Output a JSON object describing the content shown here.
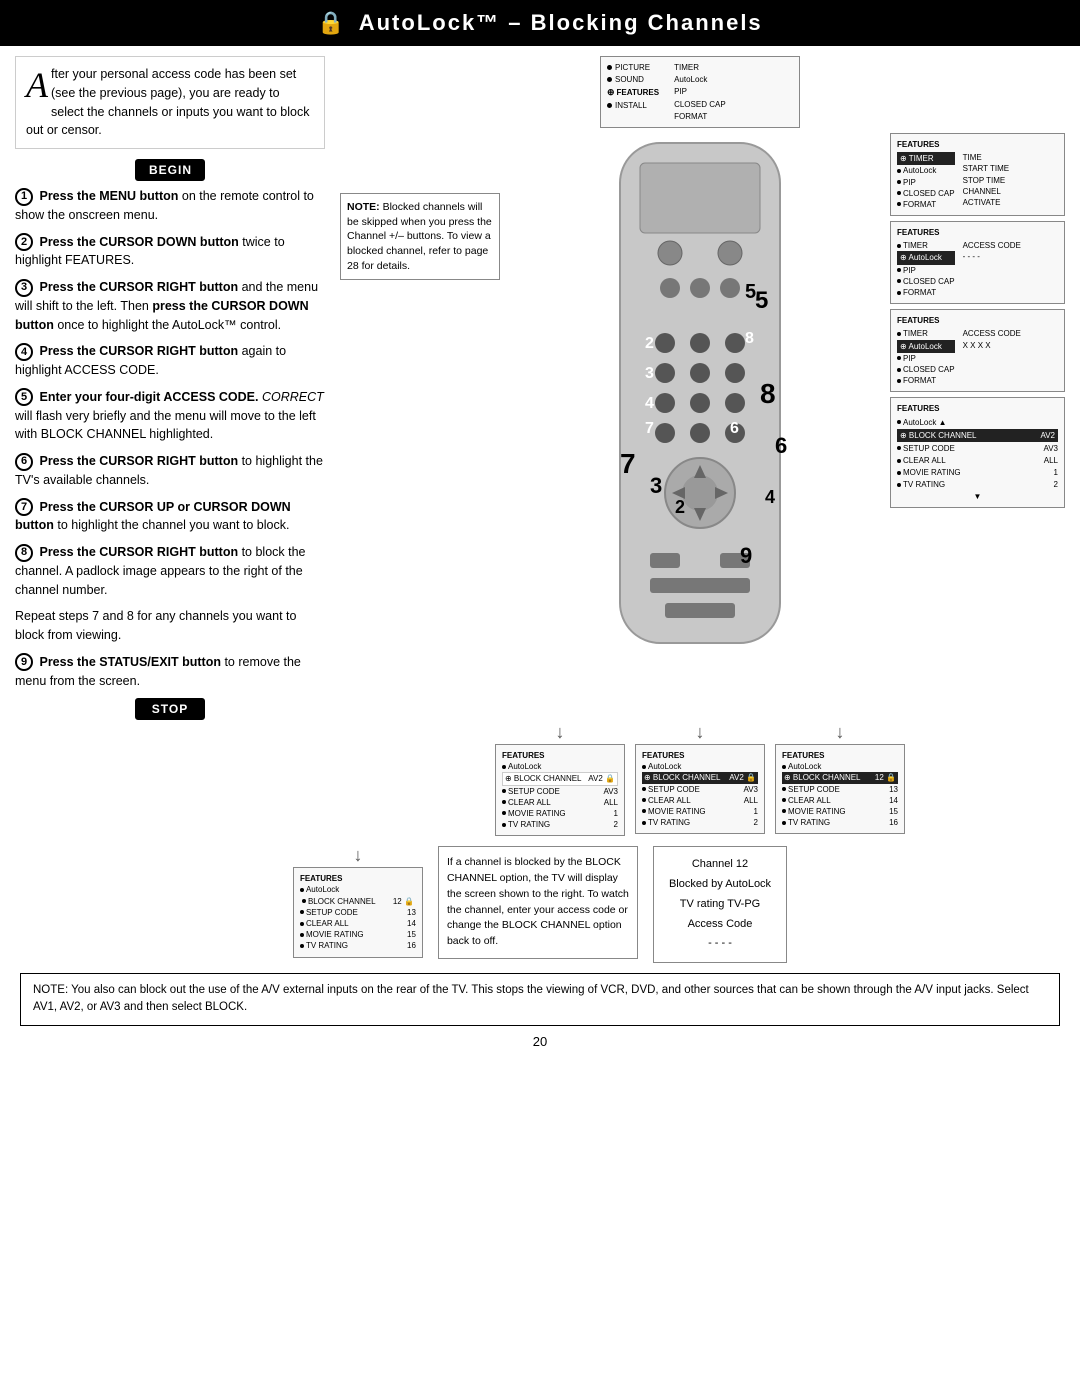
{
  "header": {
    "title": "AutoLock™ – Blocking Channels"
  },
  "intro": {
    "drop_cap": "A",
    "text": "fter your personal access code has been set (see the previous page), you are ready to select the channels or inputs you want to block out or censor."
  },
  "begin_label": "BEGIN",
  "stop_label": "STOP",
  "steps": [
    {
      "num": "1",
      "content": "Press the MENU button on the remote control to show the onscreen menu."
    },
    {
      "num": "2",
      "content": "Press the CURSOR DOWN button twice to highlight FEATURES."
    },
    {
      "num": "3",
      "content": "Press the CURSOR RIGHT button and the menu will shift to the left. Then press the CURSOR DOWN button once to highlight the AutoLock™ control."
    },
    {
      "num": "4",
      "content": "Press the CURSOR RIGHT button again to highlight ACCESS CODE."
    },
    {
      "num": "5",
      "content": "Enter your four-digit ACCESS CODE. CORRECT will flash very briefly and the menu will move to the left with BLOCK CHANNEL highlighted."
    },
    {
      "num": "6",
      "content": "Press the CURSOR RIGHT button to highlight the TV's available channels."
    },
    {
      "num": "7",
      "content": "Press the CURSOR UP or CURSOR DOWN button to highlight the channel you want to block."
    },
    {
      "num": "8",
      "content": "Press the CURSOR RIGHT button to block the channel. A padlock image appears to the right of the channel number."
    },
    {
      "num": "repeat",
      "content": "Repeat steps 7 and 8 for any channels you want to block from viewing."
    },
    {
      "num": "9",
      "content": "Press the STATUS/EXIT button to remove the menu from the screen."
    }
  ],
  "note_blocked": {
    "title": "NOTE:",
    "text": "Blocked channels will be skipped when you press the Channel +/– buttons. To view a blocked channel, refer to page 28 for details."
  },
  "bottom_note": {
    "text": "NOTE:  You also can block out the use of the A/V external inputs on the rear of the TV.  This stops the viewing of VCR, DVD, and other sources that can be shown through the A/V input jacks. Select AV1, AV2, or AV3 and then select BLOCK."
  },
  "channel_blocked_text": {
    "text": "If a channel is blocked by the BLOCK CHANNEL option, the TV will display the screen shown to the right. To watch the channel, enter your access code or change the BLOCK CHANNEL option back to off."
  },
  "channel_info": {
    "line1": "Channel 12",
    "line2": "Blocked by AutoLock",
    "line3": "TV rating  TV-PG",
    "line4": "Access Code",
    "line5": "- - - -"
  },
  "page_number": "20",
  "panels": {
    "p1": {
      "title": "FEATURES",
      "items": [
        {
          "label": "PICTURE",
          "right": "TIMER"
        },
        {
          "label": "SOUND",
          "right": "AutoLock"
        },
        {
          "label": "FEATURES",
          "right": "PIP",
          "highlight": true
        },
        {
          "label": "INSTALL",
          "right": "CLOSED CAP"
        },
        {
          "label": "",
          "right": "FORMAT"
        }
      ]
    },
    "p2": {
      "title": "FEATURES",
      "highlight": "TIMER",
      "items": [
        {
          "label": "AutoLock",
          "right": "TIME"
        },
        {
          "label": "PIP",
          "right": "START TIME"
        },
        {
          "label": "CLOSED CAP",
          "right": "STOP TIME"
        },
        {
          "label": "FORMAT",
          "right": "CHANNEL"
        },
        {
          "label": "",
          "right": "ACTIVATE"
        }
      ]
    },
    "p3": {
      "title": "FEATURES",
      "highlight": "AutoLock",
      "sub": "- - - -",
      "items": [
        {
          "label": "TIMER"
        },
        {
          "label": "PIP"
        },
        {
          "label": "CLOSED CAP"
        },
        {
          "label": "FORMAT"
        }
      ]
    },
    "p4": {
      "title": "FEATURES",
      "highlight": "AutoLock",
      "access": "X X X X",
      "items": [
        {
          "label": "TIMER"
        },
        {
          "label": "PIP"
        },
        {
          "label": "CLOSED CAP"
        },
        {
          "label": "FORMAT"
        }
      ]
    },
    "p5": {
      "title": "FEATURES",
      "items": [
        {
          "label": "AutoLock"
        },
        {
          "label": "BLOCK CHANNEL",
          "right": "AV2",
          "highlight": true
        },
        {
          "label": "SETUP CODE",
          "right": "AV3"
        },
        {
          "label": "CLEAR ALL",
          "right": "ALL"
        },
        {
          "label": "MOVIE RATING",
          "right": "1"
        },
        {
          "label": "TV RATING",
          "right": "2"
        }
      ]
    },
    "p6": {
      "title": "FEATURES",
      "items": [
        {
          "label": "AutoLock"
        },
        {
          "label": "BLOCK CHANNEL",
          "right": "AV2 🔒",
          "highlight": true
        },
        {
          "label": "SETUP CODE",
          "right": "AV3"
        },
        {
          "label": "CLEAR ALL",
          "right": "ALL"
        },
        {
          "label": "MOVIE RATING",
          "right": "1"
        },
        {
          "label": "TV RATING",
          "right": "2"
        }
      ]
    },
    "p7": {
      "title": "FEATURES",
      "items": [
        {
          "label": "AutoLock"
        },
        {
          "label": "BLOCK CHANNEL",
          "right": "12 🔒",
          "highlight": true
        },
        {
          "label": "SETUP CODE",
          "right": "13"
        },
        {
          "label": "CLEAR ALL",
          "right": "14"
        },
        {
          "label": "MOVIE RATING",
          "right": "15"
        },
        {
          "label": "TV RATING",
          "right": "16"
        }
      ]
    },
    "p8": {
      "title": "FEATURES",
      "items": [
        {
          "label": "AutoLock"
        },
        {
          "label": "BLOCK CHANNEL",
          "right": "12 🔒"
        },
        {
          "label": "SETUP CODE",
          "right": "13"
        },
        {
          "label": "CLEAR ALL",
          "right": "14"
        },
        {
          "label": "MOVIE RATING",
          "right": "15"
        },
        {
          "label": "TV RATING",
          "right": "16"
        }
      ]
    }
  }
}
